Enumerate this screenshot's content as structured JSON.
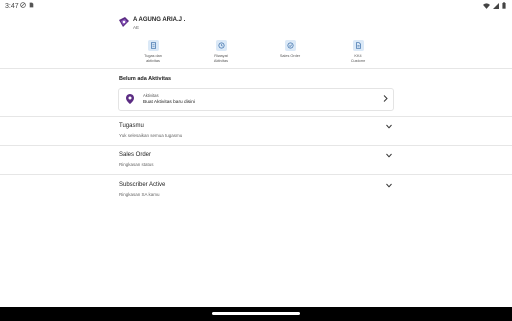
{
  "status_bar": {
    "time": "3:47"
  },
  "header": {
    "user_name": "A AGUNG ARIA.J .",
    "user_sub": "AE"
  },
  "shortcuts": [
    {
      "label_line1": "Tugas dan",
      "label_line2": "aktivitas",
      "icon": "clipboard-icon"
    },
    {
      "label_line1": "Riwayat",
      "label_line2": "Aktivitas",
      "icon": "history-icon"
    },
    {
      "label_line1": "Sales Order",
      "label_line2": "",
      "icon": "check-circle-icon"
    },
    {
      "label_line1": "KK4",
      "label_line2": "Customr",
      "icon": "document-icon"
    }
  ],
  "activity": {
    "section_title": "Belum ada Aktivitas",
    "card_title": "Aktivitas",
    "card_desc": "Buat Aktivitas baru disini"
  },
  "sections": [
    {
      "title": "Tugasmu",
      "subtitle": "Yuk selesaikan semua tugasmu"
    },
    {
      "title": "Sales Order",
      "subtitle": "Ringkasan status"
    },
    {
      "title": "Subscriber Active",
      "subtitle": "Ringkasan SA kamu"
    }
  ],
  "colors": {
    "accent": "#5b2c83",
    "shortcut_bg": "#dbe9f7",
    "shortcut_icon": "#3b6ea8"
  }
}
